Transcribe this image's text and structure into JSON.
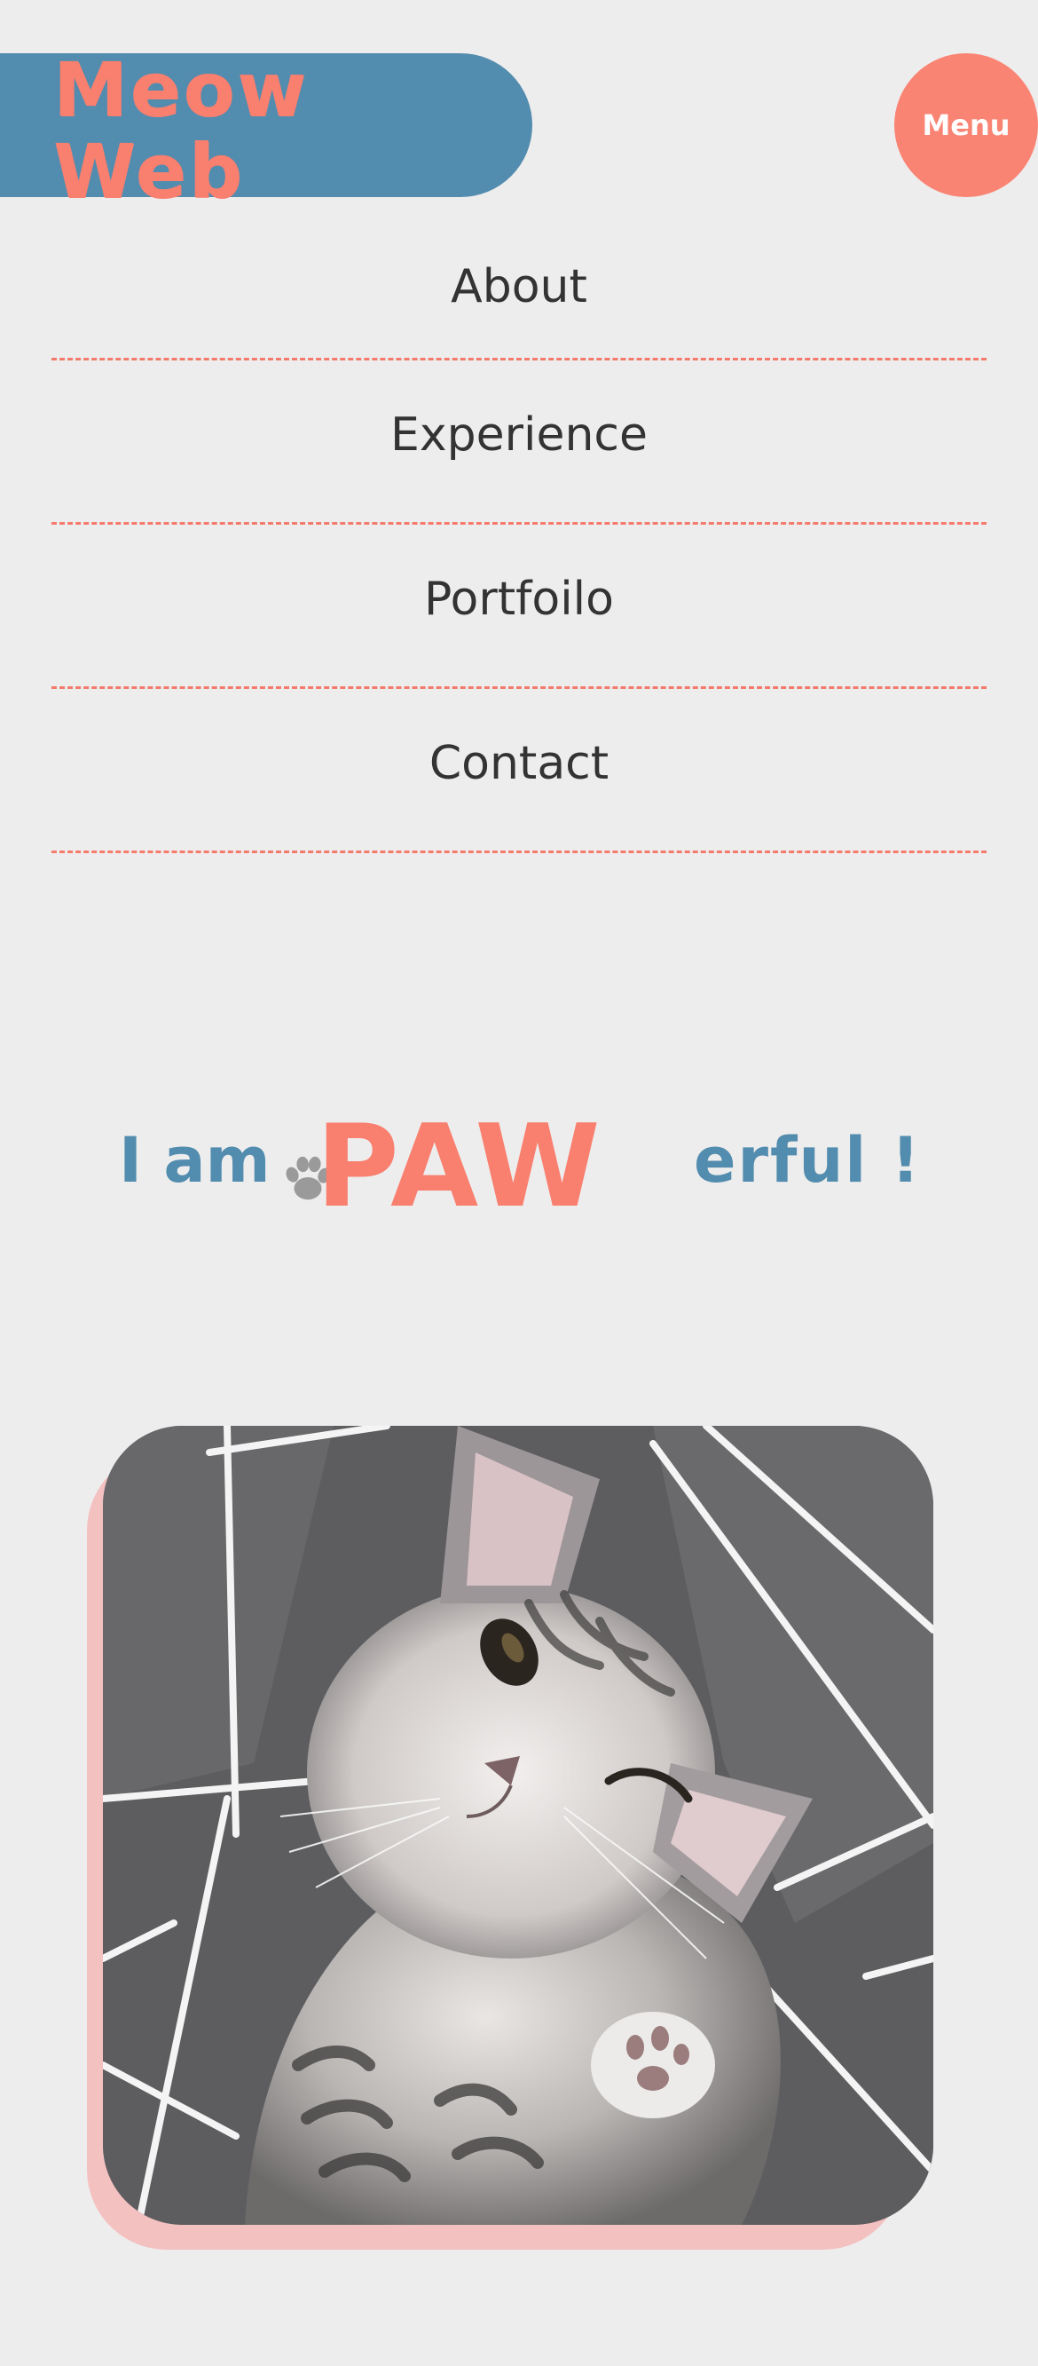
{
  "header": {
    "logo_text": "Meow\nWeb",
    "menu_label": "Menu"
  },
  "nav": {
    "items": [
      {
        "label": "About"
      },
      {
        "label": "Experience"
      },
      {
        "label": "Portfoilo"
      },
      {
        "label": "Contact"
      }
    ]
  },
  "hero": {
    "prefix": "I am",
    "highlight": "PAW",
    "suffix": "erful !"
  },
  "colors": {
    "background": "#eeeded",
    "brand_blue": "#528cae",
    "brand_coral": "#f97f6f",
    "divider": "#f47a6b",
    "photo_shadow": "#f4c1c1",
    "paw_icon": "#9a9a9a"
  },
  "icons": {
    "paw": "paw-print-icon"
  }
}
